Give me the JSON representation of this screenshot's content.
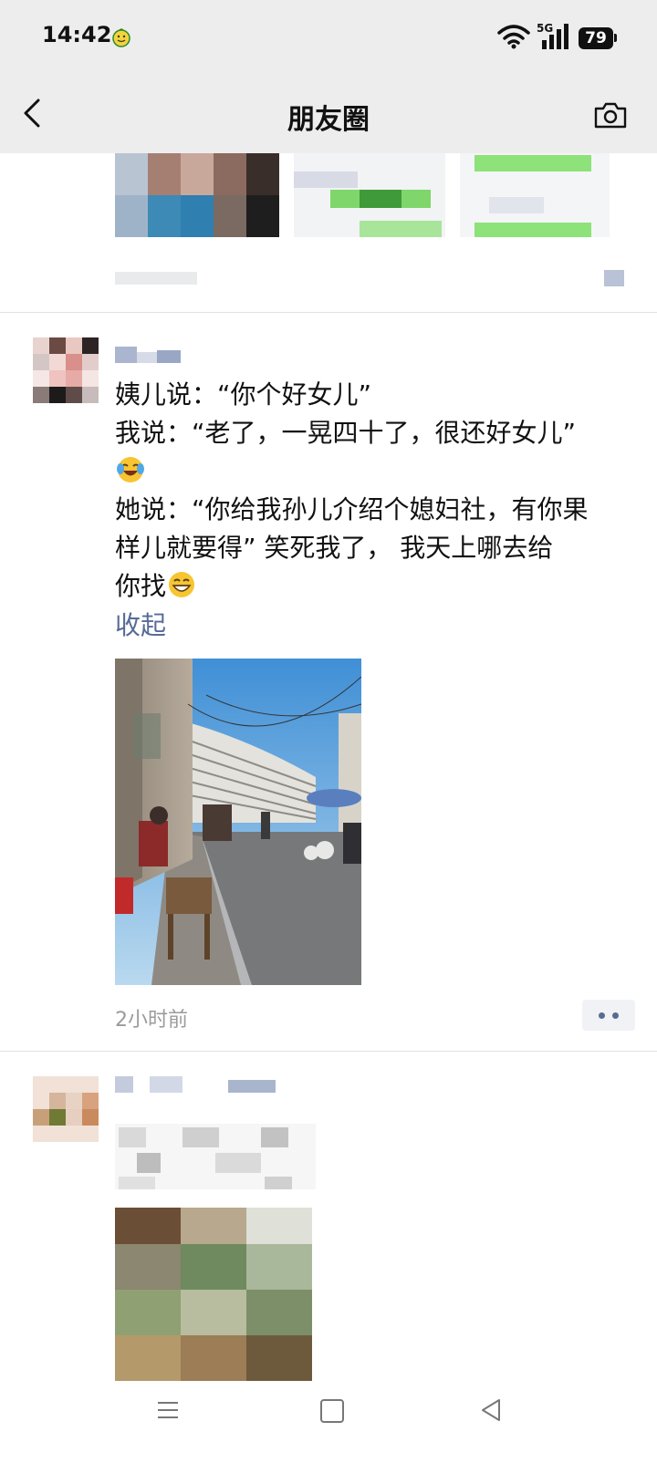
{
  "status_bar": {
    "time": "14:42",
    "network": "5G",
    "battery": "79"
  },
  "nav": {
    "title": "朋友圈"
  },
  "posts": [
    {
      "lines": [
        "姨儿说：“你个好女儿”",
        "我说：“老了，一晃四十了，很还好女儿”",
        "她说：“你给我孙儿介绍个媳妇社，有你果",
        "样儿就要得” 笑死我了， 我天上哪去给",
        "你找"
      ],
      "collapse_label": "收起",
      "timestamp": "2小时前"
    }
  ],
  "icons": {
    "back": "chevron-left-icon",
    "camera": "camera-icon",
    "laugh_emoji": "laughing-tears-emoji",
    "grin_emoji": "grinning-emoji",
    "more": "more-dots-icon"
  },
  "colors": {
    "link": "#576b95",
    "bar_bg": "#ededed",
    "meta_text": "#9b9b9b"
  }
}
